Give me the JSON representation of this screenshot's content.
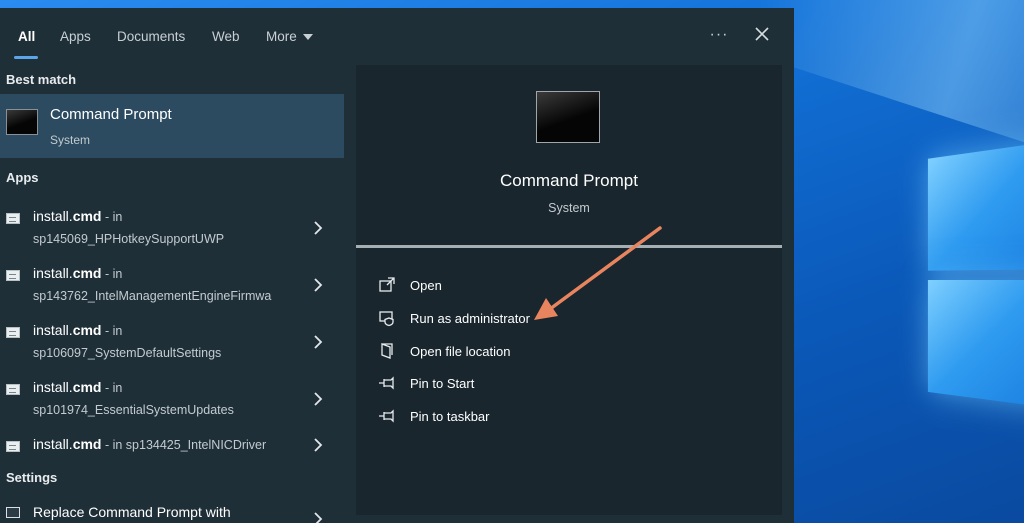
{
  "tabs": {
    "all": "All",
    "apps": "Apps",
    "documents": "Documents",
    "web": "Web",
    "more": "More",
    "more_options": "···"
  },
  "sections": {
    "best_match": "Best match",
    "apps": "Apps",
    "settings": "Settings"
  },
  "best_match": {
    "title": "Command Prompt",
    "subtitle": "System"
  },
  "apps": [
    {
      "name_plain": "install.",
      "name_bold": "cmd",
      "suffix": " - in",
      "location": "sp145069_HPHotkeySupportUWP"
    },
    {
      "name_plain": "install.",
      "name_bold": "cmd",
      "suffix": " - in",
      "location": "sp143762_IntelManagementEngineFirmwa"
    },
    {
      "name_plain": "install.",
      "name_bold": "cmd",
      "suffix": " - in",
      "location": "sp106097_SystemDefaultSettings"
    },
    {
      "name_plain": "install.",
      "name_bold": "cmd",
      "suffix": " - in",
      "location": "sp101974_EssentialSystemUpdates"
    },
    {
      "name_plain": "install.",
      "name_bold": "cmd",
      "suffix": " - in sp134425_IntelNICDriver",
      "location": ""
    }
  ],
  "settings": {
    "item": "Replace Command Prompt with"
  },
  "detail": {
    "title": "Command Prompt",
    "subtitle": "System",
    "actions": {
      "open": "Open",
      "run_admin": "Run as administrator",
      "open_location": "Open file location",
      "pin_start": "Pin to Start",
      "pin_taskbar": "Pin to taskbar"
    }
  },
  "colors": {
    "panel": "#1f2f38",
    "detail_panel": "#19262e",
    "selected": "#2c4b60",
    "accent": "#5aa6e8",
    "arrow": "#e8855f"
  }
}
